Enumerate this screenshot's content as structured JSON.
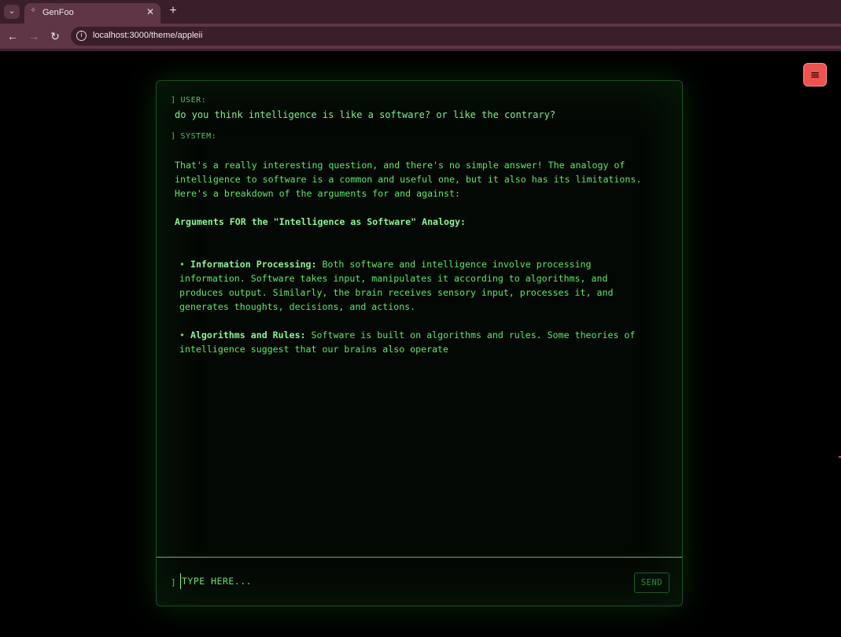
{
  "browser": {
    "tab": {
      "title": "GenFoo",
      "close_glyph": "✕",
      "favicon": "sparkle-icon"
    },
    "tab_search_glyph": "⌄",
    "new_tab_glyph": "+",
    "nav": {
      "back": "←",
      "forward": "→",
      "reload": "↻"
    },
    "site_info_glyph": "i",
    "url": "localhost:3000/theme/appleii"
  },
  "page": {
    "menu_button_glyph": "≡",
    "colors": {
      "accent": "#5ee66c",
      "menu": "#ef5350",
      "background": "#000000"
    },
    "conversation": {
      "user_label": "USER:",
      "user_message": "do you think intelligence is like a software? or like the contrary?",
      "system_label": "SYSTEM:",
      "bracket": "]",
      "system_intro": "That's a really interesting question, and there's no simple answer! The analogy of intelligence to software is a common and useful one, but it also has its limitations. Here's a breakdown of the arguments for and against:",
      "system_heading": "Arguments FOR the \"Intelligence as Software\" Analogy:",
      "bullets": [
        {
          "marker": "•",
          "title": "Information Processing:",
          "text": " Both software and intelligence involve processing information. Software takes input, manipulates it according to algorithms, and produces output. Similarly, the brain receives sensory input, processes it, and generates thoughts, decisions, and actions."
        },
        {
          "marker": "•",
          "title": "Algorithms and Rules:",
          "text": " Software is built on algorithms and rules. Some theories of intelligence suggest that our brains also operate"
        }
      ]
    },
    "input": {
      "prompt": "]",
      "placeholder": "TYPE HERE...",
      "value": "",
      "send_label": "SEND"
    }
  }
}
